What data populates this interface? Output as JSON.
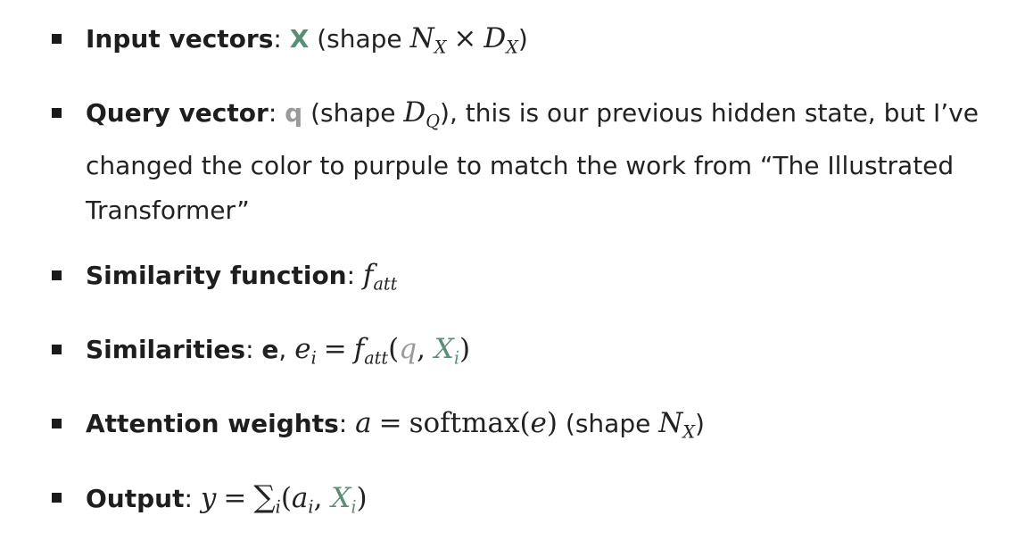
{
  "items": [
    {
      "term": "Input vectors",
      "sep": ": ",
      "symbol": "X",
      "rest_open": " (shape ",
      "math": {
        "n": "N",
        "n_sub": "X",
        "times": "×",
        "d": "D",
        "d_sub": "X"
      },
      "rest_close": ")"
    },
    {
      "term": "Query vector",
      "sep": ": ",
      "symbol": "q",
      "rest_open": " (shape ",
      "math": {
        "d": "D",
        "d_sub": "Q"
      },
      "rest_close": "), this is our previous hidden state, but I’ve changed the color to purpule to match the work from “The Illustrated Transformer”"
    },
    {
      "term": "Similarity function",
      "sep": ": ",
      "math": {
        "f": "f",
        "f_sub": "att"
      }
    },
    {
      "term": "Similarities",
      "sep": ": ",
      "symbol": "e",
      "comma": ", ",
      "math": {
        "e": "e",
        "e_sub": "i",
        "eq": "=",
        "f": "f",
        "f_sub": "att",
        "open": "(",
        "q": "q",
        "comma": ", ",
        "x": "X",
        "x_sub": "i",
        "close": ")"
      }
    },
    {
      "term": "Attention weights",
      "sep": ": ",
      "math": {
        "a": "a",
        "eq": "=",
        "fn": "softmax",
        "open": "(",
        "e": "e",
        "close": ")"
      },
      "rest_open": " (shape ",
      "shape": {
        "n": "N",
        "n_sub": "X"
      },
      "rest_close": ")"
    },
    {
      "term": "Output",
      "sep": ": ",
      "math": {
        "y": "y",
        "eq": "=",
        "sum": "∑",
        "sum_sub": "i",
        "open": "(",
        "a": "a",
        "a_sub": "i",
        "comma": ", ",
        "x": "X",
        "x_sub": "i",
        "close": ")"
      }
    }
  ]
}
